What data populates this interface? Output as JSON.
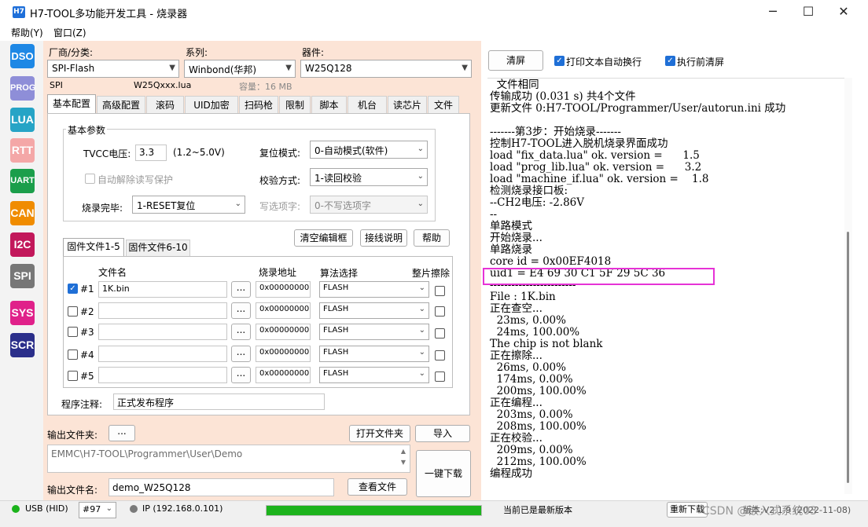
{
  "window": {
    "icon_text": "H7",
    "title": "H7-TOOL多功能开发工具 - 烧录器",
    "min_glyph": "─",
    "max_glyph": "☐",
    "close_glyph": "✕"
  },
  "menu": [
    "帮助(Y)",
    "窗口(Z)"
  ],
  "sidebar": [
    "DSO",
    "PROG",
    "LUA",
    "RTT",
    "UART",
    "CAN",
    "I2C",
    "SPI",
    "SYS",
    "SCR"
  ],
  "selectors": {
    "vendor_label": "厂商/分类:",
    "vendor_value": "SPI-Flash",
    "series_label": "系列:",
    "series_value": "Winbond(华邦)",
    "device_label": "器件:",
    "device_value": "W25Q128",
    "iface": "SPI",
    "lua_file": "W25Qxxx.lua",
    "capacity": "容量：16 MB"
  },
  "tabs": [
    "基本配置",
    "高级配置",
    "滚码",
    "UID加密",
    "扫码枪",
    "限制",
    "脚本",
    "机台",
    "读芯片",
    "文件"
  ],
  "basic": {
    "group_title": "基本参数",
    "tvcc_label": "TVCC电压:",
    "tvcc_value": "3.3",
    "tvcc_range": "(1.2~5.0V)",
    "reset_label": "复位模式:",
    "reset_value": "0-自动模式(软件)",
    "auto_unprotect": "自动解除读写保护",
    "verify_label": "校验方式:",
    "verify_value": "1-读回校验",
    "done_label": "烧录完毕:",
    "done_value": "1-RESET复位",
    "option_label": "写选项字:",
    "option_value": "0-不写选项字"
  },
  "file_buttons": {
    "clear": "清空编辑框",
    "wiring": "接线说明",
    "help": "帮助"
  },
  "file_tabs": [
    "固件文件1-5",
    "固件文件6-10"
  ],
  "file_table": {
    "headers": [
      "文件名",
      "烧录地址",
      "算法选择",
      "整片擦除"
    ],
    "browse": "...",
    "rows": [
      {
        "no": "#1",
        "checked": true,
        "file": "1K.bin",
        "addr": "0x00000000",
        "algo": "FLASH"
      },
      {
        "no": "#2",
        "checked": false,
        "file": "",
        "addr": "0x00000000",
        "algo": "FLASH"
      },
      {
        "no": "#3",
        "checked": false,
        "file": "",
        "addr": "0x00000000",
        "algo": "FLASH"
      },
      {
        "no": "#4",
        "checked": false,
        "file": "",
        "addr": "0x00000000",
        "algo": "FLASH"
      },
      {
        "no": "#5",
        "checked": false,
        "file": "",
        "addr": "0x00000000",
        "algo": "FLASH"
      }
    ]
  },
  "note": {
    "label": "程序注释:",
    "value": "正式发布程序"
  },
  "output": {
    "folder_label": "输出文件夹:",
    "folder_btn": "...",
    "open_folder": "打开文件夹",
    "import": "导入",
    "path": "EMMC\\H7-TOOL\\Programmer\\User\\Demo",
    "one_click": "一键下载",
    "name_label": "输出文件名:",
    "name_value": "demo_W25Q128",
    "view_file": "查看文件"
  },
  "right": {
    "clear": "清屏",
    "wrap": "打印文本自动换行",
    "clear_before": "执行前清屏"
  },
  "console_lines": [
    "  文件相同",
    "传输成功 (0.031 s) 共4个文件",
    "更新文件 0:H7-TOOL/Programmer/User/autorun.ini 成功",
    "",
    "-------第3步：开始烧录-------",
    "控制H7-TOOL进入脱机烧录界面成功",
    "load \"fix_data.lua\" ok. version =      1.5",
    "load \"prog_lib.lua\" ok. version =      3.2",
    "load \"machine_if.lua\" ok. version =    1.8",
    "检测烧录接口板:",
    "--CH2电压: -2.86V",
    "--",
    "单路模式",
    "开始烧录...",
    "单路烧录",
    "core id = 0x00EF4018",
    "uid1 = E4 69 30 C1 5F 29 5C 36",
    "------------------------",
    "File : 1K.bin",
    "正在查空...",
    "  23ms, 0.00%",
    "  24ms, 100.00%",
    "The chip is not blank",
    "正在擦除...",
    "  26ms, 0.00%",
    "  174ms, 0.00%",
    "  200ms, 100.00%",
    "正在编程...",
    "  203ms, 0.00%",
    "  208ms, 100.00%",
    "正在校验...",
    "  209ms, 0.00%",
    "  212ms, 100.00%",
    "编程成功"
  ],
  "status": {
    "usb": "USB (HID)",
    "port": "#97",
    "ip": "IP (192.168.0.101)",
    "progress": 1.0,
    "version_msg": "当前已是最新版本",
    "refresh": "重新下载",
    "version": "版本:V2.1.9 (2022-11-08)",
    "watermark": "CSDN @嵌入式系统03"
  },
  "colors": {
    "DSO": "#1e88e5",
    "PROG": "#8e8ed8",
    "LUA": "#26a4c6",
    "RTT": "#f4a7a7",
    "UART": "#1b9e4b",
    "CAN": "#f08c00",
    "I2C": "#c2185b",
    "SPI": "#777777",
    "SYS": "#e0218a",
    "SCR": "#2b2f8a",
    "progress": "#1db31d",
    "highlight": "#e632d6"
  }
}
